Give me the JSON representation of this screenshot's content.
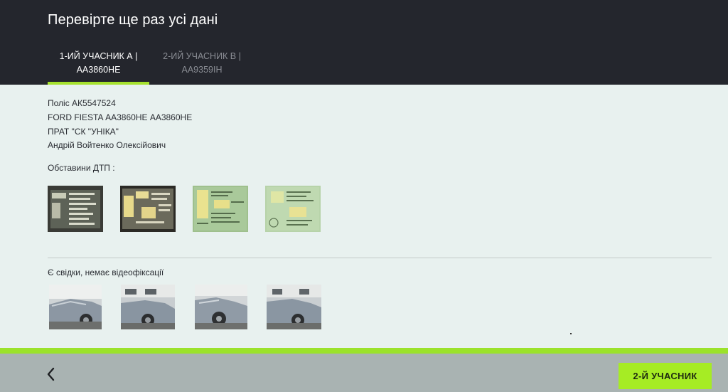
{
  "header": {
    "title": "Перевірте ще раз усі дані",
    "tabs": [
      {
        "line1": "1-ИЙ УЧАСНИК А |",
        "line2": "АА3860НЕ",
        "active": true
      },
      {
        "line1": "2-ИЙ УЧАСНИК В |",
        "line2": "АА9359ІН",
        "active": false
      }
    ],
    "accent_color": "#a6e22e"
  },
  "info": {
    "policy": "Поліс АК5547524",
    "vehicle": "FORD FIESTA АА3860НЕ АА3860НЕ",
    "insurer": "ПРАТ \"СК \"УНІКА\"",
    "driver": "Андрій Войтенко Олексійович"
  },
  "circumstances_label": "Обставини ДТП :",
  "documents": [
    {
      "type": "document-photo",
      "tone": "dark"
    },
    {
      "type": "document-photo",
      "tone": "dark-yellow"
    },
    {
      "type": "document-photo",
      "tone": "green"
    },
    {
      "type": "document-photo",
      "tone": "green-light"
    }
  ],
  "witness_label": "Є свідки, немає відеофіксації",
  "car_photos": [
    {
      "type": "car-damage-photo"
    },
    {
      "type": "car-damage-photo"
    },
    {
      "type": "car-damage-photo"
    },
    {
      "type": "car-damage-photo"
    }
  ],
  "footer": {
    "back_icon": "chevron-left-icon",
    "next_label": "2-Й УЧАСНИК",
    "next_color": "#a6ec24"
  }
}
